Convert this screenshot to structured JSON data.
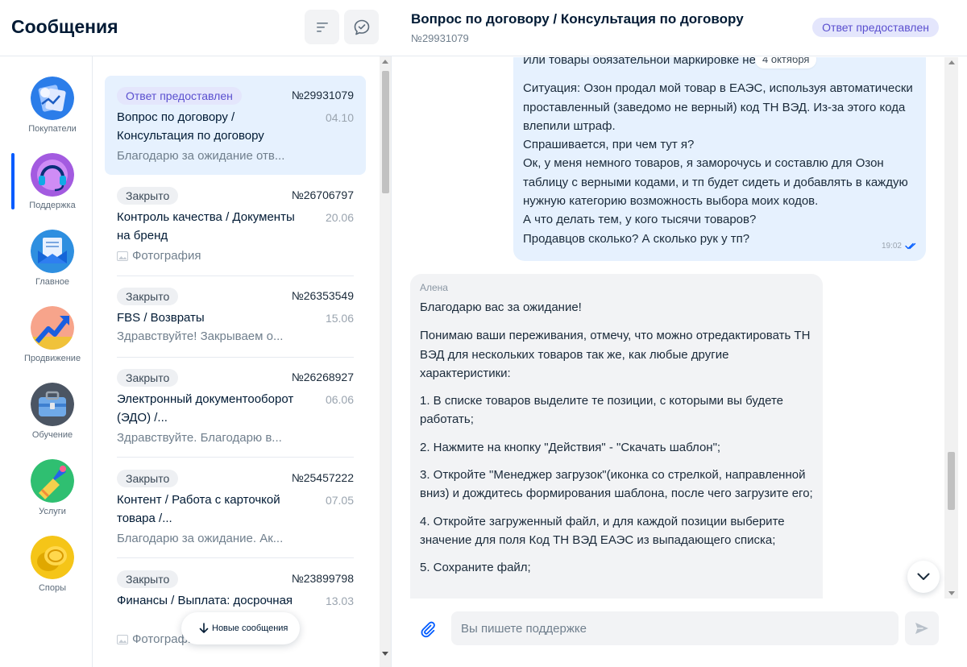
{
  "left_header": {
    "title": "Сообщения",
    "filter_icon": "filter-lines-icon",
    "new_chat_icon": "chat-check-icon"
  },
  "rail": {
    "active_index": 1,
    "items": [
      {
        "label": "Покупатели",
        "icon": "buyers-icon",
        "color": "#2b7de9"
      },
      {
        "label": "Поддержка",
        "icon": "headset-icon",
        "color": "#a35be0"
      },
      {
        "label": "Главное",
        "icon": "newspaper-envelope-icon",
        "color": "#2e8fe0"
      },
      {
        "label": "Продвижение",
        "icon": "growth-arrow-icon",
        "color": "#f7a48b"
      },
      {
        "label": "Обучение",
        "icon": "briefcase-icon",
        "color": "#64748b"
      },
      {
        "label": "Услуги",
        "icon": "brush-services-icon",
        "color": "#2fbf71"
      },
      {
        "label": "Споры",
        "icon": "coins-icon",
        "color": "#f5c518"
      }
    ]
  },
  "tickets": [
    {
      "status": "Ответ предоставлен",
      "status_type": "answered",
      "number": "№29931079",
      "date": "04.10",
      "title": "Вопрос по договору / Консультация по договору",
      "preview": "Благодарю за ожидание отв...",
      "active": true
    },
    {
      "status": "Закрыто",
      "status_type": "closed",
      "number": "№26706797",
      "date": "20.06",
      "title": "Контроль качества / Документы на бренд",
      "preview": "Фотография",
      "preview_is_photo": true
    },
    {
      "status": "Закрыто",
      "status_type": "closed",
      "number": "№26353549",
      "date": "15.06",
      "title": "FBS / Возвраты",
      "preview": "Здравствуйте! Закрываем о..."
    },
    {
      "status": "Закрыто",
      "status_type": "closed",
      "number": "№26268927",
      "date": "06.06",
      "title": "Электронный документооборот (ЭДО) /...",
      "preview": "Здравствуйте. Благодарю в..."
    },
    {
      "status": "Закрыто",
      "status_type": "closed",
      "number": "№25457222",
      "date": "07.05",
      "title": "Контент / Работа с карточкой товара /...",
      "preview": "Благодарю за ожидание. Ак..."
    },
    {
      "status": "Закрыто",
      "status_type": "closed",
      "number": "№23899798",
      "date": "13.03",
      "title": "Финансы / Выплата: досрочная",
      "preview": "Фотография",
      "preview_is_photo": true
    }
  ],
  "new_messages_label": "Новые сообщения",
  "conversation": {
    "title": "Вопрос по договору / Консультация по договору",
    "number": "№29931079",
    "status": "Ответ предоставлен",
    "date_chip": "4 октября",
    "outgoing": {
      "lines": [
        "Или товары обязательной маркировке не подлежат.",
        "Ситуация: Озон продал мой товар в ЕАЭС, используя автоматически проставленный (заведомо не верный) код ТН ВЭД. Из-за этого кода влепили штраф.",
        "Спрашивается, при чем тут я?",
        "Ок, у меня немного товаров, я заморочусь и составлю для Озон таблицу с верными кодами, и тп будет сидеть и добавлять в каждую нужную категорию возможность выбора моих кодов.",
        "А что делать тем, у кого тысячи товаров?",
        "Продавцов сколько? А сколько рук у тп?"
      ],
      "time": "19:02",
      "read_icon": "double-check-icon"
    },
    "incoming": {
      "sender": "Алена",
      "paragraphs": [
        "Благодарю вас за ожидание!",
        "Понимаю ваши переживания, отмечу, что можно отредактировать ТН ВЭД для нескольких товаров так же, как любые другие характеристики:",
        "1. В списке товаров выделите те позиции, с которыми вы будете работать;",
        "2. Нажмите на кнопку \"Действия\" - \"Скачать шаблон\";",
        "3. Откройте \"Менеджер загрузок\"(иконка со стрелкой, направленной вниз) и дождитесь формирования шаблона, после чего загрузите его;",
        "4. Откройте загруженный файл, и для каждой позиции выберите значение для поля Код ТН ВЭД ЕАЭС из выпадающего списка;",
        "5. Сохраните файл;"
      ]
    }
  },
  "composer": {
    "placeholder": "Вы пишете поддержке",
    "attach_icon": "paperclip-icon",
    "send_icon": "send-arrow-icon"
  },
  "colors": {
    "accent": "#005bff",
    "answered_badge_bg": "#e4e6fc",
    "answered_badge_text": "#5a4fcf",
    "outgoing_bubble": "#e6f1fe",
    "incoming_bubble": "#f2f3f5"
  }
}
